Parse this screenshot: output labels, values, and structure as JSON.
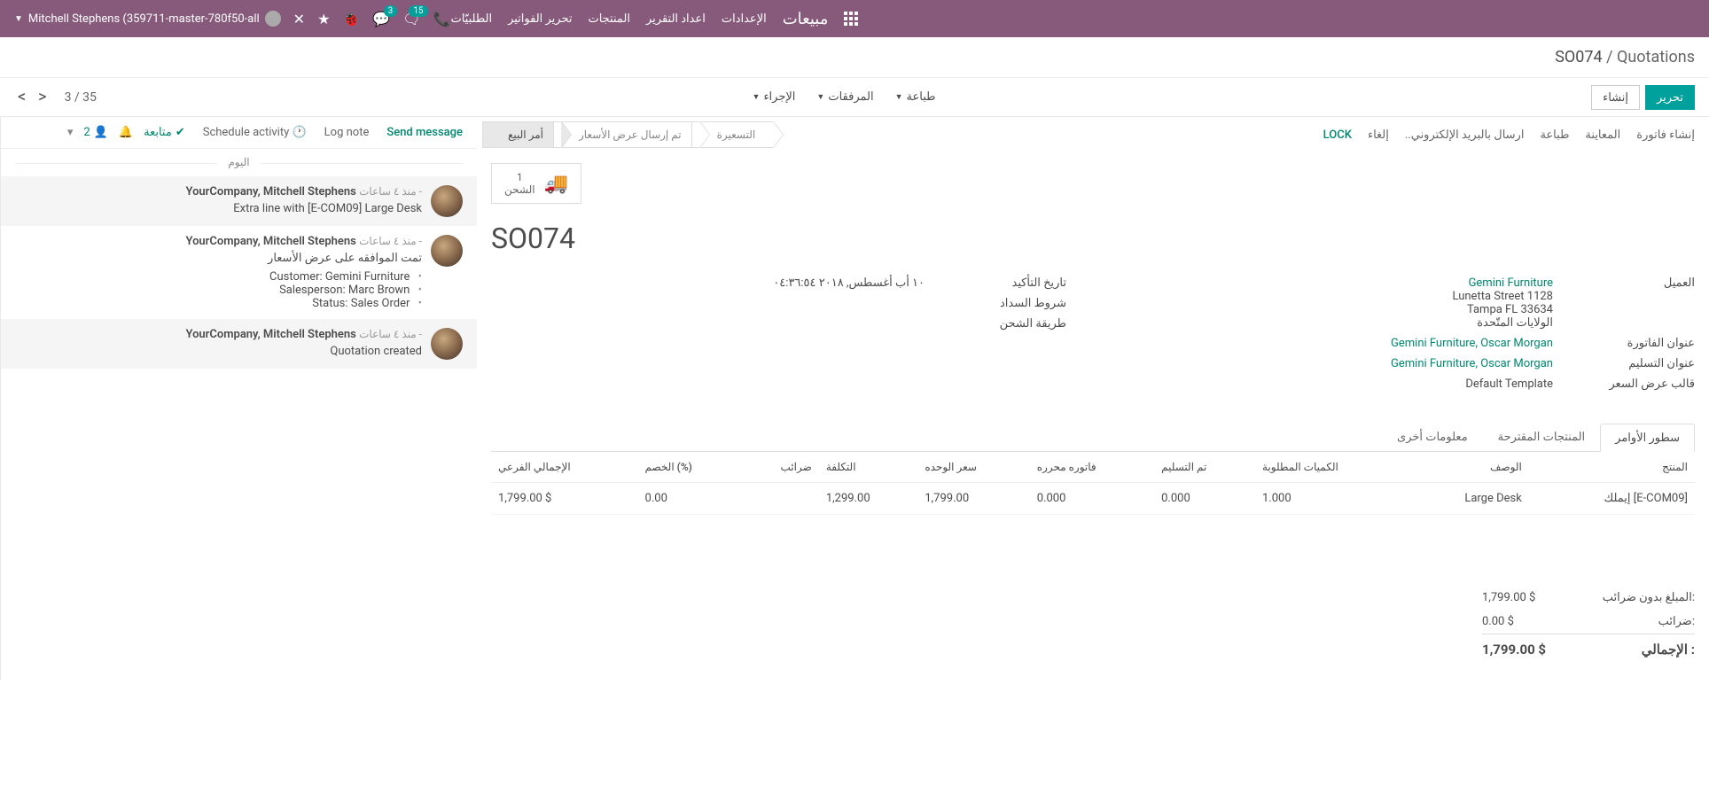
{
  "topbar": {
    "user_env": "Mitchell Stephens (359711-master-780f50-all",
    "badge_chat": "3",
    "badge_talk": "15",
    "nav": [
      "الطلبيّات",
      "تحرير الفواتير",
      "المنتجات",
      "اعداد التقرير",
      "الإعدادات"
    ],
    "brand": "مبيعات"
  },
  "breadcrumb": {
    "parent": "Quotations",
    "sep": " / ",
    "current": "SO074"
  },
  "controls": {
    "edit": "تحرير",
    "create": "إنشاء",
    "print": "طباعة",
    "attach": "المرفقات",
    "action": "الإجراء",
    "pager": "3 / 35"
  },
  "statusbar": {
    "create_invoice": "إنشاء فاتورة",
    "preview": "المعاينة",
    "print": "طباعة",
    "send_email": "ارسال بالبريد الإلكتروني..",
    "cancel": "إلغاء",
    "lock": "LOCK",
    "steps": {
      "sent": "تم إرسال عرض الأسعار",
      "quote": "التسعيرة",
      "order": "أمر البيع"
    }
  },
  "stat": {
    "count": "1",
    "label": "الشحن"
  },
  "order": {
    "name": "SO074",
    "labels": {
      "customer": "العميل",
      "invoice_addr": "عنوان الفاتورة",
      "delivery_addr": "عنوان التسليم",
      "template": "قالب عرض السعر",
      "confirm_date": "تاريخ التأكيد",
      "payment_terms": "شروط السداد",
      "shipping": "طريقة الشحن"
    },
    "customer": {
      "name": "Gemini Furniture",
      "street": "Lunetta Street 1128",
      "city": "Tampa FL 33634",
      "country": "الولايات المتّحدة"
    },
    "invoice_addr": "Gemini Furniture, Oscar Morgan",
    "delivery_addr": "Gemini Furniture, Oscar Morgan",
    "template": "Default Template",
    "confirm_date": "١٠ أب أغسطس, ٢٠١٨ ٠٤:٣٦:٥٤"
  },
  "tabs": {
    "lines": "سطور الأوامر",
    "optional": "المنتجات المقترحة",
    "other": "معلومات أخرى"
  },
  "table": {
    "headers": {
      "product": "المنتج",
      "desc": "الوصف",
      "qty": "الكميات المطلوبة",
      "delivered": "تم التسليم",
      "invoiced": "فاتوره محرره",
      "unit_price": "سعر الوحده",
      "cost": "التكلفة",
      "taxes": "ضرائب",
      "discount": "الخصم (%)",
      "subtotal": "الإجمالي الفرعي"
    },
    "rows": [
      {
        "product": "[E-COM09] إيملك",
        "desc": "Large Desk",
        "qty": "1.000",
        "delivered": "0.000",
        "invoiced": "0.000",
        "unit_price": "1,799.00",
        "cost": "1,299.00",
        "taxes": "",
        "discount": "0.00",
        "subtotal": "1,799.00 $"
      }
    ]
  },
  "totals": {
    "untaxed_label": "المبلغ بدون ضرائب:",
    "untaxed_value": "1,799.00 $",
    "taxes_label": "ضرائب:",
    "taxes_value": "0.00 $",
    "total_label": "الإجمالي :",
    "total_value": "1,799.00 $"
  },
  "chatter": {
    "send": "Send message",
    "log": "Log note",
    "schedule": "Schedule activity",
    "follow": "متابعة",
    "followers": "2",
    "today": "اليوم",
    "messages": [
      {
        "author": "YourCompany, Mitchell Stephens",
        "time": "- منذ ٤ ساعات",
        "lines": [
          "Extra line with [E-COM09] Large Desk"
        ]
      },
      {
        "author": "YourCompany, Mitchell Stephens",
        "time": "- منذ ٤ ساعات",
        "lines": [
          "تمت الموافقه على عرض الأسعار"
        ],
        "bullets": [
          "Customer: Gemini Furniture",
          "Salesperson: Marc Brown",
          "Status: Sales Order"
        ]
      },
      {
        "author": "YourCompany, Mitchell Stephens",
        "time": "- منذ ٤ ساعات",
        "lines": [
          "Quotation created"
        ]
      }
    ]
  }
}
